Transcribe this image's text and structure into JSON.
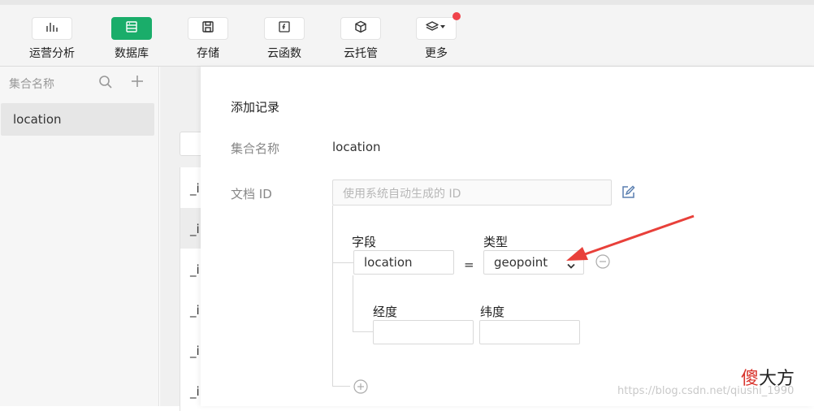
{
  "toolbar": {
    "items": [
      {
        "label": "运营分析",
        "icon": "bar-chart-icon"
      },
      {
        "label": "数据库",
        "icon": "database-icon"
      },
      {
        "label": "存储",
        "icon": "save-icon"
      },
      {
        "label": "云函数",
        "icon": "function-icon"
      },
      {
        "label": "云托管",
        "icon": "cube-icon"
      },
      {
        "label": "更多",
        "icon": "layers-icon"
      }
    ],
    "accent_color": "#1aad6a",
    "badge_color": "#f0434b"
  },
  "sidebar": {
    "header": "集合名称",
    "collections": [
      "location"
    ]
  },
  "background_list": {
    "row_prefix": "_i"
  },
  "modal": {
    "title": "添加记录",
    "collection_label": "集合名称",
    "collection_value": "location",
    "doc_id_label": "文档 ID",
    "doc_id_placeholder": "使用系统自动生成的 ID",
    "field_header": "字段",
    "type_header": "类型",
    "field_value": "location",
    "equals": "=",
    "type_value": "geopoint",
    "longitude_label": "经度",
    "latitude_label": "纬度",
    "longitude_value": "",
    "latitude_value": ""
  },
  "watermark": {
    "logo_red": "傻",
    "logo_black": "大方",
    "url": "https://blog.csdn.net/qiushi_1990"
  }
}
